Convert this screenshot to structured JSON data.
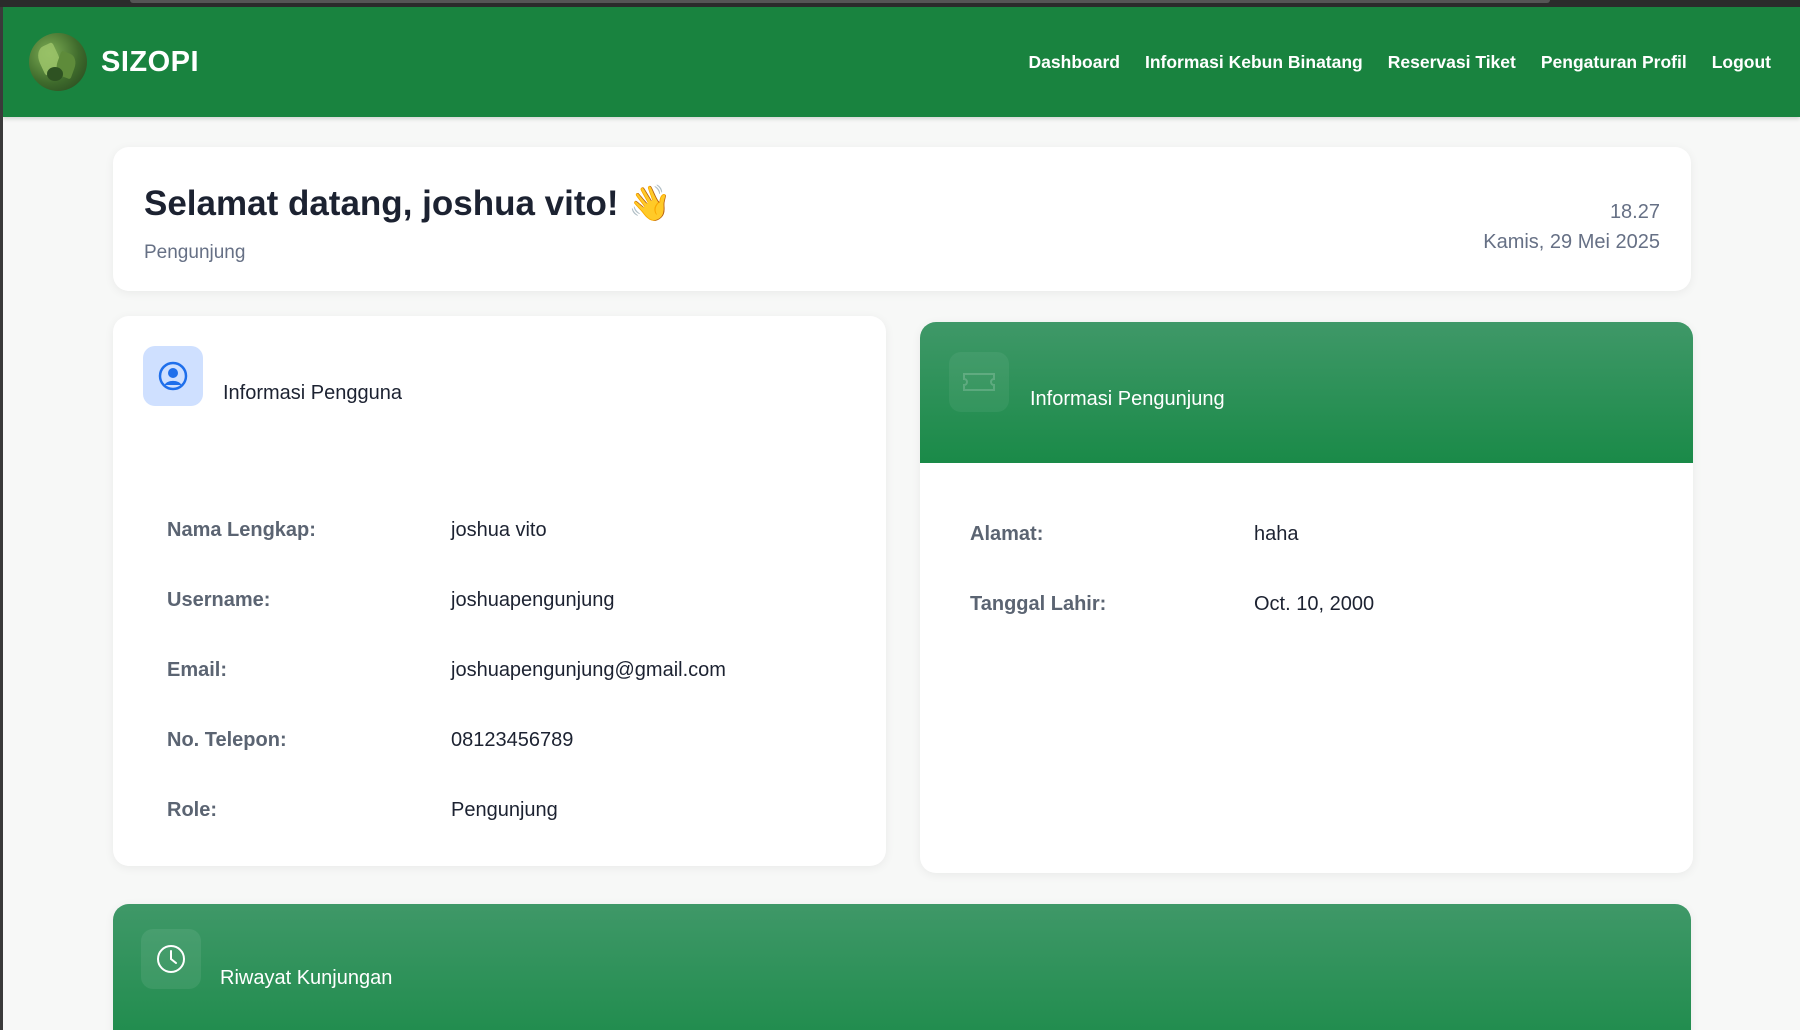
{
  "brand": {
    "name": "SIZOPI"
  },
  "nav": {
    "items": [
      "Dashboard",
      "Informasi Kebun Binatang",
      "Reservasi Tiket",
      "Pengaturan Profil",
      "Logout"
    ]
  },
  "welcome": {
    "greeting": "Selamat datang, joshua vito! 👋",
    "role": "Pengunjung",
    "time": "18.27",
    "date": "Kamis, 29 Mei 2025"
  },
  "user_info": {
    "title": "Informasi Pengguna",
    "icon": "user-circle-icon",
    "rows": [
      {
        "label": "Nama Lengkap:",
        "value": "joshua vito"
      },
      {
        "label": "Username:",
        "value": "joshuapengunjung"
      },
      {
        "label": "Email:",
        "value": "joshuapengunjung@gmail.com"
      },
      {
        "label": "No. Telepon:",
        "value": "08123456789"
      },
      {
        "label": "Role:",
        "value": "Pengunjung"
      }
    ]
  },
  "visitor_info": {
    "title": "Informasi Pengunjung",
    "icon": "ticket-icon",
    "rows": [
      {
        "label": "Alamat:",
        "value": "haha"
      },
      {
        "label": "Tanggal Lahir:",
        "value": "Oct. 10, 2000"
      }
    ]
  },
  "visit_history": {
    "title": "Riwayat Kunjungan",
    "icon": "clock-icon"
  },
  "colors": {
    "navbar": "#19833f",
    "accent_green": "#1a8a48",
    "user_icon_bg": "#cfe0ff",
    "user_icon": "#1f6feb"
  }
}
